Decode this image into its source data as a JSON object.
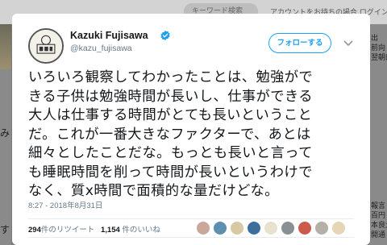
{
  "background": {
    "search_placeholder": "キーワード検索",
    "login_text": "アカウントをお持ちの場合 ログイン",
    "right_fragments": [
      "出",
      "前向",
      "翌朝的",
      "報言",
      "百円",
      "本良大",
      "開通"
    ],
    "left_fragments": [
      "み",
      "す"
    ]
  },
  "tweet": {
    "author_name": "Kazuki Fujisawa",
    "author_handle": "@kazu_fujisawa",
    "follow_label": "フォローする",
    "text": "いろいろ観察してわかったことは、勉強がで\nきる子供は勉強時間が長いし、仕事ができる\n大人は仕事する時間がとても長いということ\nだ。これが一番大きなファクターで、あとは\n細々としたことだな。もっとも長いと言って\nも睡眠時間を削って時間が長いというわけで\nなく、質x時間で面積的な量だけどな。",
    "timestamp": "8:27 - 2018年8月31日",
    "retweets": {
      "count": "294",
      "label": "件のリツイート"
    },
    "likes": {
      "count": "1,154",
      "label": " 件のいいね"
    }
  },
  "colors": {
    "accent": "#1da1f2",
    "text": "#14171a",
    "muted": "#657786"
  },
  "likers": [
    {
      "name": "liker-avatar-1",
      "color": "#c9a89a"
    },
    {
      "name": "liker-avatar-2",
      "color": "#5d8fb0"
    },
    {
      "name": "liker-avatar-3",
      "color": "#d8c9a4"
    },
    {
      "name": "liker-avatar-4",
      "color": "#3c6e9c"
    },
    {
      "name": "liker-avatar-5",
      "color": "#e8e1d0"
    },
    {
      "name": "liker-avatar-6",
      "color": "#8a8f94"
    },
    {
      "name": "liker-avatar-7",
      "color": "#cc5a4a"
    },
    {
      "name": "liker-avatar-8",
      "color": "#b4b0a8"
    },
    {
      "name": "liker-avatar-9",
      "color": "#e5d6b8"
    }
  ]
}
